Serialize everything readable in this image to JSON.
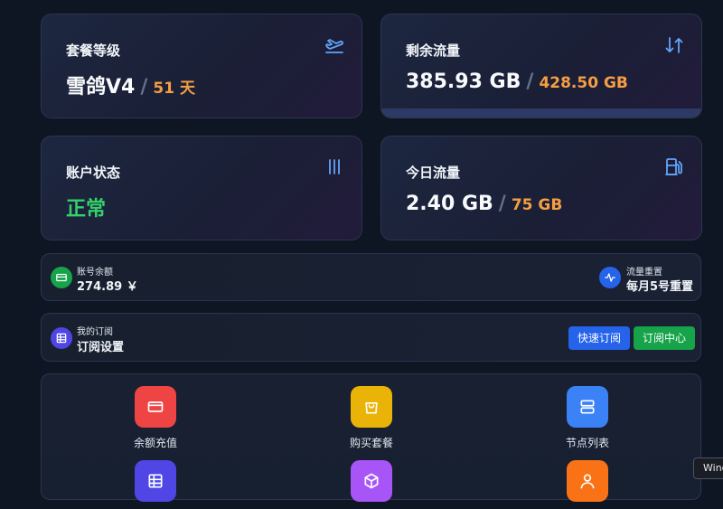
{
  "stats": {
    "plan": {
      "label": "套餐等级",
      "name": "雪鸽V4",
      "days": "51 天",
      "icon": "airplane-takeoff-icon"
    },
    "traffic_left": {
      "label": "剩余流量",
      "remaining": "385.93 GB",
      "total": "428.50 GB",
      "used_fraction": 0.9,
      "icon": "arrows-up-down-icon"
    },
    "account_status": {
      "label": "账户状态",
      "value": "正常",
      "icon": "bars-icon"
    },
    "today_traffic": {
      "label": "今日流量",
      "used": "2.40 GB",
      "limit": "75 GB",
      "icon": "fuel-pump-icon"
    }
  },
  "balance_row": {
    "balance_label": "账号余额",
    "balance_value": "274.89 ￥",
    "reset_label": "流量重置",
    "reset_value": "每月5号重置"
  },
  "subscription_row": {
    "small_label": "我的订阅",
    "main_label": "订阅设置",
    "quick_button": "快速订阅",
    "center_button": "订阅中心"
  },
  "tiles": [
    {
      "label": "余额充值",
      "color": "#ef4444",
      "icon": "wallet-icon"
    },
    {
      "label": "购买套餐",
      "color": "#eab308",
      "icon": "shopping-bag-icon"
    },
    {
      "label": "节点列表",
      "color": "#3b82f6",
      "icon": "server-icon"
    },
    {
      "label": "",
      "color": "#4f46e5",
      "icon": "table-icon"
    },
    {
      "label": "",
      "color": "#a855f7",
      "icon": "package-icon"
    },
    {
      "label": "",
      "color": "#f97316",
      "icon": "user-icon"
    }
  ],
  "tooltip": {
    "text": "Wind"
  }
}
